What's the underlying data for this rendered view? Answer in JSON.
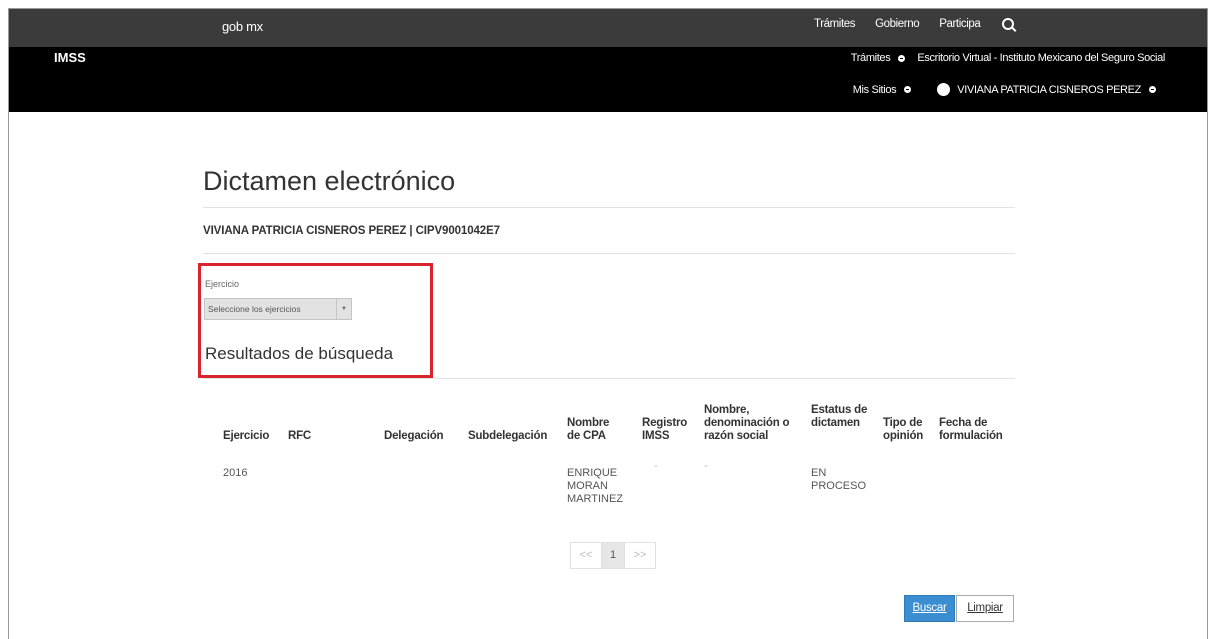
{
  "gob_header": {
    "logo": "gob mx",
    "links": [
      "Trámites",
      "Gobierno",
      "Participa"
    ]
  },
  "imss_header": {
    "brand": "IMSS",
    "tramites_label": "Trámites",
    "escritorio_label": "Escritorio Virtual - Instituto Mexicano del Seguro Social",
    "mis_sitios_label": "Mis Sitios",
    "user_name": "VIVIANA PATRICIA CISNEROS PEREZ"
  },
  "main": {
    "title": "Dictamen electrónico",
    "user_line": "VIVIANA PATRICIA CISNEROS PEREZ | CIPV9001042E7",
    "ejercicio_label": "Ejercicio",
    "ejercicio_select_value": "Seleccione los ejercicios",
    "results_title": "Resultados de búsqueda"
  },
  "table": {
    "headers": {
      "ejercicio": "Ejercicio",
      "rfc": "RFC",
      "delegacion": "Delegación",
      "subdelegacion": "Subdelegación",
      "nombre_cpa": "Nombre de CPA",
      "registro_imss": "Registro IMSS",
      "razon_social": "Nombre, denominación o razón social",
      "estatus": "Estatus de dictamen",
      "tipo_opinion": "Tipo de opinión",
      "fecha": "Fecha de formulación"
    },
    "rows": [
      {
        "ejercicio": "2016",
        "rfc": "",
        "delegacion": "",
        "subdelegacion": "",
        "nombre_cpa": "ENRIQUE MORAN MARTINEZ",
        "registro_imss": "-",
        "razon_social": "-",
        "estatus": "EN PROCESO",
        "tipo_opinion": "",
        "fecha": ""
      }
    ]
  },
  "pagination": {
    "prev": "<<",
    "current": "1",
    "next": ">>"
  },
  "buttons": {
    "buscar": "Buscar",
    "limpiar": "Limpiar"
  },
  "colors": {
    "gob_bar": "#3b3b3b",
    "imss_bar": "#000000",
    "highlight_border": "#d9232d",
    "primary_button": "#3a8ed1"
  }
}
